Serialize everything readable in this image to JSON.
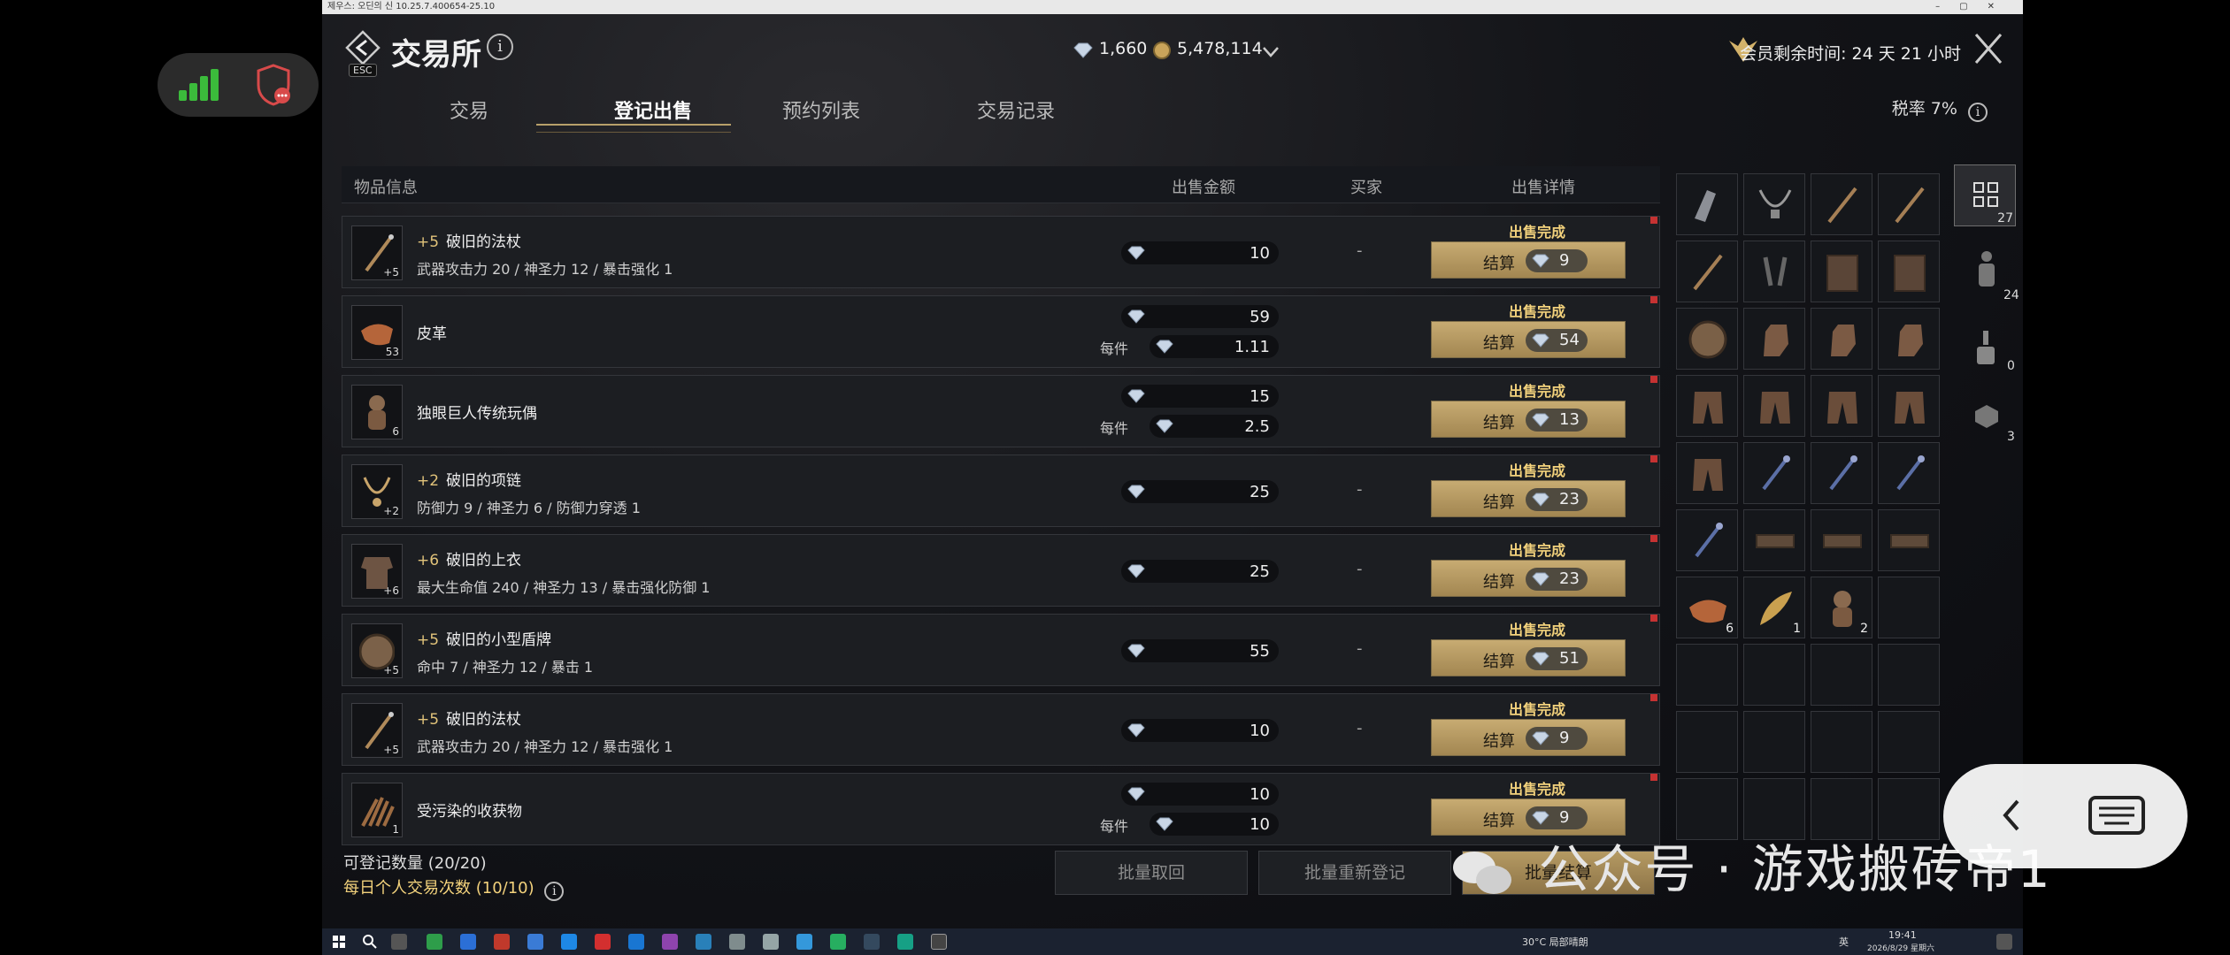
{
  "window": {
    "titlebar_text": "제우스: 오딘의 신 10.25.7.400654-25.10"
  },
  "header": {
    "esc_label": "ESC",
    "title": "交易所",
    "diamond_amount": "1,660",
    "gold_amount": "5,478,114",
    "membership": "会员剩余时间:  24 天 21 小时",
    "tax_rate": "税率 7%"
  },
  "tabs": [
    {
      "label": "交易",
      "active": false
    },
    {
      "label": "登记出售",
      "active": true
    },
    {
      "label": "预约列表",
      "active": false
    },
    {
      "label": "交易记录",
      "active": false
    }
  ],
  "table": {
    "headers": {
      "item_info": "物品信息",
      "price": "出售金额",
      "buyer": "买家",
      "detail": "出售详情"
    },
    "status_text": "出售完成",
    "settle_label": "结算",
    "per_unit_label": "每件",
    "rows": [
      {
        "plus": "+5",
        "name": "破旧的法杖",
        "stats": "武器攻击力 20 / 神圣力 12 / 暴击强化 1",
        "count": "+5",
        "price": "10",
        "per": "",
        "buyer": "-",
        "settle": "9",
        "icon": "staff-icon"
      },
      {
        "plus": "",
        "name": "皮革",
        "stats": "",
        "count": "53",
        "price": "59",
        "per": "1.11",
        "buyer": "",
        "settle": "54",
        "icon": "leather-icon"
      },
      {
        "plus": "",
        "name": "独眼巨人传统玩偶",
        "stats": "",
        "count": "6",
        "price": "15",
        "per": "2.5",
        "buyer": "",
        "settle": "13",
        "icon": "doll-icon"
      },
      {
        "plus": "+2",
        "name": "破旧的项链",
        "stats": "防御力 9 / 神圣力 6 / 防御力穿透 1",
        "count": "+2",
        "price": "25",
        "per": "",
        "buyer": "-",
        "settle": "23",
        "icon": "necklace-icon"
      },
      {
        "plus": "+6",
        "name": "破旧的上衣",
        "stats": "最大生命值 240 / 神圣力 13 / 暴击强化防御 1",
        "count": "+6",
        "price": "25",
        "per": "",
        "buyer": "-",
        "settle": "23",
        "icon": "armor-icon"
      },
      {
        "plus": "+5",
        "name": "破旧的小型盾牌",
        "stats": "命中 7 / 神圣力 12 / 暴击 1",
        "count": "+5",
        "price": "55",
        "per": "",
        "buyer": "-",
        "settle": "51",
        "icon": "shield-item-icon"
      },
      {
        "plus": "+5",
        "name": "破旧的法杖",
        "stats": "武器攻击力 20 / 神圣力 12 / 暴击强化 1",
        "count": "+5",
        "price": "10",
        "per": "",
        "buyer": "-",
        "settle": "9",
        "icon": "staff-icon"
      },
      {
        "plus": "",
        "name": "受污染的收获物",
        "stats": "",
        "count": "1",
        "price": "10",
        "per": "10",
        "buyer": "",
        "settle": "9",
        "icon": "claw-icon"
      }
    ]
  },
  "footer": {
    "register_count": "可登记数量 (20/20)",
    "daily_trades": "每日个人交易次数 (10/10)",
    "btn_cancel": "批量取回",
    "btn_relist": "批量重新登记",
    "btn_settle": "批量结算"
  },
  "inventory": {
    "side_counts": [
      "27",
      "24",
      "0",
      "3"
    ],
    "cells": [
      {
        "icon": "gauntlet-icon",
        "count": ""
      },
      {
        "icon": "necklace-icon",
        "count": ""
      },
      {
        "icon": "staff-icon",
        "count": ""
      },
      {
        "icon": "staff-icon",
        "count": ""
      },
      {
        "icon": "staff-icon",
        "count": ""
      },
      {
        "icon": "dagger-icon",
        "count": ""
      },
      {
        "icon": "book-icon",
        "count": ""
      },
      {
        "icon": "book-icon",
        "count": ""
      },
      {
        "icon": "round-shield-icon",
        "count": ""
      },
      {
        "icon": "glove-icon",
        "count": ""
      },
      {
        "icon": "glove-icon",
        "count": ""
      },
      {
        "icon": "glove-icon",
        "count": ""
      },
      {
        "icon": "pants-icon",
        "count": ""
      },
      {
        "icon": "pants-icon",
        "count": ""
      },
      {
        "icon": "pants-icon",
        "count": ""
      },
      {
        "icon": "pants-icon",
        "count": ""
      },
      {
        "icon": "pants-icon",
        "count": ""
      },
      {
        "icon": "earring-icon",
        "count": ""
      },
      {
        "icon": "earring-icon",
        "count": ""
      },
      {
        "icon": "earring-icon",
        "count": ""
      },
      {
        "icon": "earring-icon",
        "count": ""
      },
      {
        "icon": "belt-icon",
        "count": ""
      },
      {
        "icon": "belt-icon",
        "count": ""
      },
      {
        "icon": "belt-icon",
        "count": ""
      },
      {
        "icon": "leather-icon",
        "count": "6"
      },
      {
        "icon": "feather-icon",
        "count": "1"
      },
      {
        "icon": "doll-icon",
        "count": "2"
      },
      {
        "icon": "",
        "count": ""
      }
    ]
  },
  "watermark": "公众号 · 游戏搬砖帝1",
  "taskbar": {
    "weather": "30°C 局部晴朗",
    "lang": "英",
    "time": "19:41",
    "date": "2026/8/29 星期六"
  },
  "colors": {
    "gold": "#c7ab72",
    "status": "#f3d27c",
    "signal": "#3bbb3b",
    "alert": "#d84a4a"
  }
}
